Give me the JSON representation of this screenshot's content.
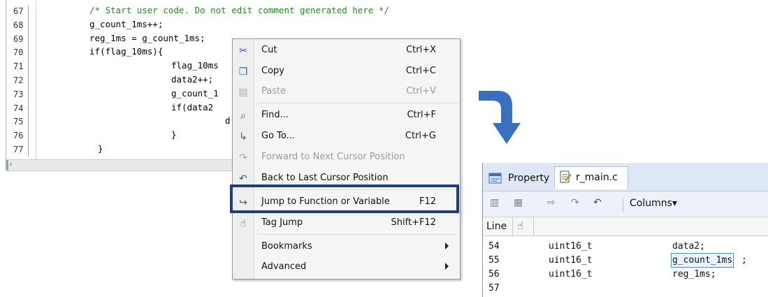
{
  "editor": {
    "lines": [
      {
        "num": "67",
        "text": "/* Start user code. Do not edit comment generated here */",
        "indent": 76,
        "kind": "comment"
      },
      {
        "num": "68",
        "text": "g_count_1ms++;",
        "indent": 76,
        "kind": "code"
      },
      {
        "num": "69",
        "text": "reg_1ms = g_count_1ms;",
        "indent": 76,
        "kind": "code"
      },
      {
        "num": "70",
        "text": "if(flag_10ms){",
        "indent": 76,
        "kind": "code"
      },
      {
        "num": "71",
        "text": "flag_10ms",
        "indent": 193,
        "kind": "code"
      },
      {
        "num": "72",
        "text": "data2++;",
        "indent": 193,
        "kind": "code"
      },
      {
        "num": "73",
        "text": "g_count_1",
        "indent": 193,
        "kind": "code"
      },
      {
        "num": "74",
        "text": "if(data2",
        "indent": 193,
        "kind": "code"
      },
      {
        "num": "75",
        "text": "d",
        "indent": 270,
        "kind": "code"
      },
      {
        "num": "76",
        "text": "}",
        "indent": 193,
        "kind": "code"
      },
      {
        "num": "77",
        "text": "}",
        "indent": 88,
        "kind": "code"
      }
    ],
    "scroll_arrow": "‹"
  },
  "context_menu": {
    "items": [
      {
        "label": "Cut",
        "shortcut": "Ctrl+X",
        "icon": "scissors-icon",
        "glyph": "✂",
        "disabled": false
      },
      {
        "label": "Copy",
        "shortcut": "Ctrl+C",
        "icon": "copy-icon",
        "glyph": "❐",
        "disabled": false
      },
      {
        "label": "Paste",
        "shortcut": "Ctrl+V",
        "icon": "paste-icon",
        "glyph": "▤",
        "disabled": true
      },
      {
        "label": "Find...",
        "shortcut": "Ctrl+F",
        "icon": "binoculars-icon",
        "glyph": "⌕",
        "disabled": false
      },
      {
        "label": "Go To...",
        "shortcut": "Ctrl+G",
        "icon": "goto-icon",
        "glyph": "↳",
        "disabled": false
      },
      {
        "label": "Forward to Next Cursor Position",
        "shortcut": "",
        "icon": "forward-icon",
        "glyph": "↷",
        "disabled": true
      },
      {
        "label": "Back to Last Cursor Position",
        "shortcut": "",
        "icon": "back-icon",
        "glyph": "↶",
        "disabled": false
      },
      {
        "label": "Jump to Function or Variable",
        "shortcut": "F12",
        "icon": "jump-icon",
        "glyph": "↪",
        "disabled": false
      },
      {
        "label": "Tag Jump",
        "shortcut": "Shift+F12",
        "icon": "tag-jump-icon",
        "glyph": "☝",
        "disabled": false
      },
      {
        "label": "Bookmarks",
        "shortcut": "",
        "icon": "",
        "glyph": "",
        "disabled": false,
        "submenu": true
      },
      {
        "label": "Advanced",
        "shortcut": "",
        "icon": "",
        "glyph": "",
        "disabled": false,
        "submenu": true
      }
    ],
    "highlight_color": "#1f3e7d"
  },
  "arrow": {
    "color": "#3a6fc0"
  },
  "panel": {
    "tabs": [
      {
        "label": "Property",
        "icon": "property-icon"
      },
      {
        "label": "r_main.c",
        "icon": "file-icon"
      }
    ],
    "toolbar": {
      "columns_label": "Columns▾"
    },
    "header": {
      "line_label": "Line",
      "icon": "pointer-hand-icon"
    },
    "rows": [
      {
        "num": "54",
        "type": "uint16_t",
        "name": "data2;",
        "selected": false
      },
      {
        "num": "55",
        "type": "uint16_t",
        "name": "g_count_1ms",
        "suffix": ";",
        "selected": true
      },
      {
        "num": "56",
        "type": "uint16_t",
        "name": "reg_1ms;",
        "selected": false
      },
      {
        "num": "57",
        "type": "",
        "name": "",
        "selected": false
      }
    ]
  }
}
